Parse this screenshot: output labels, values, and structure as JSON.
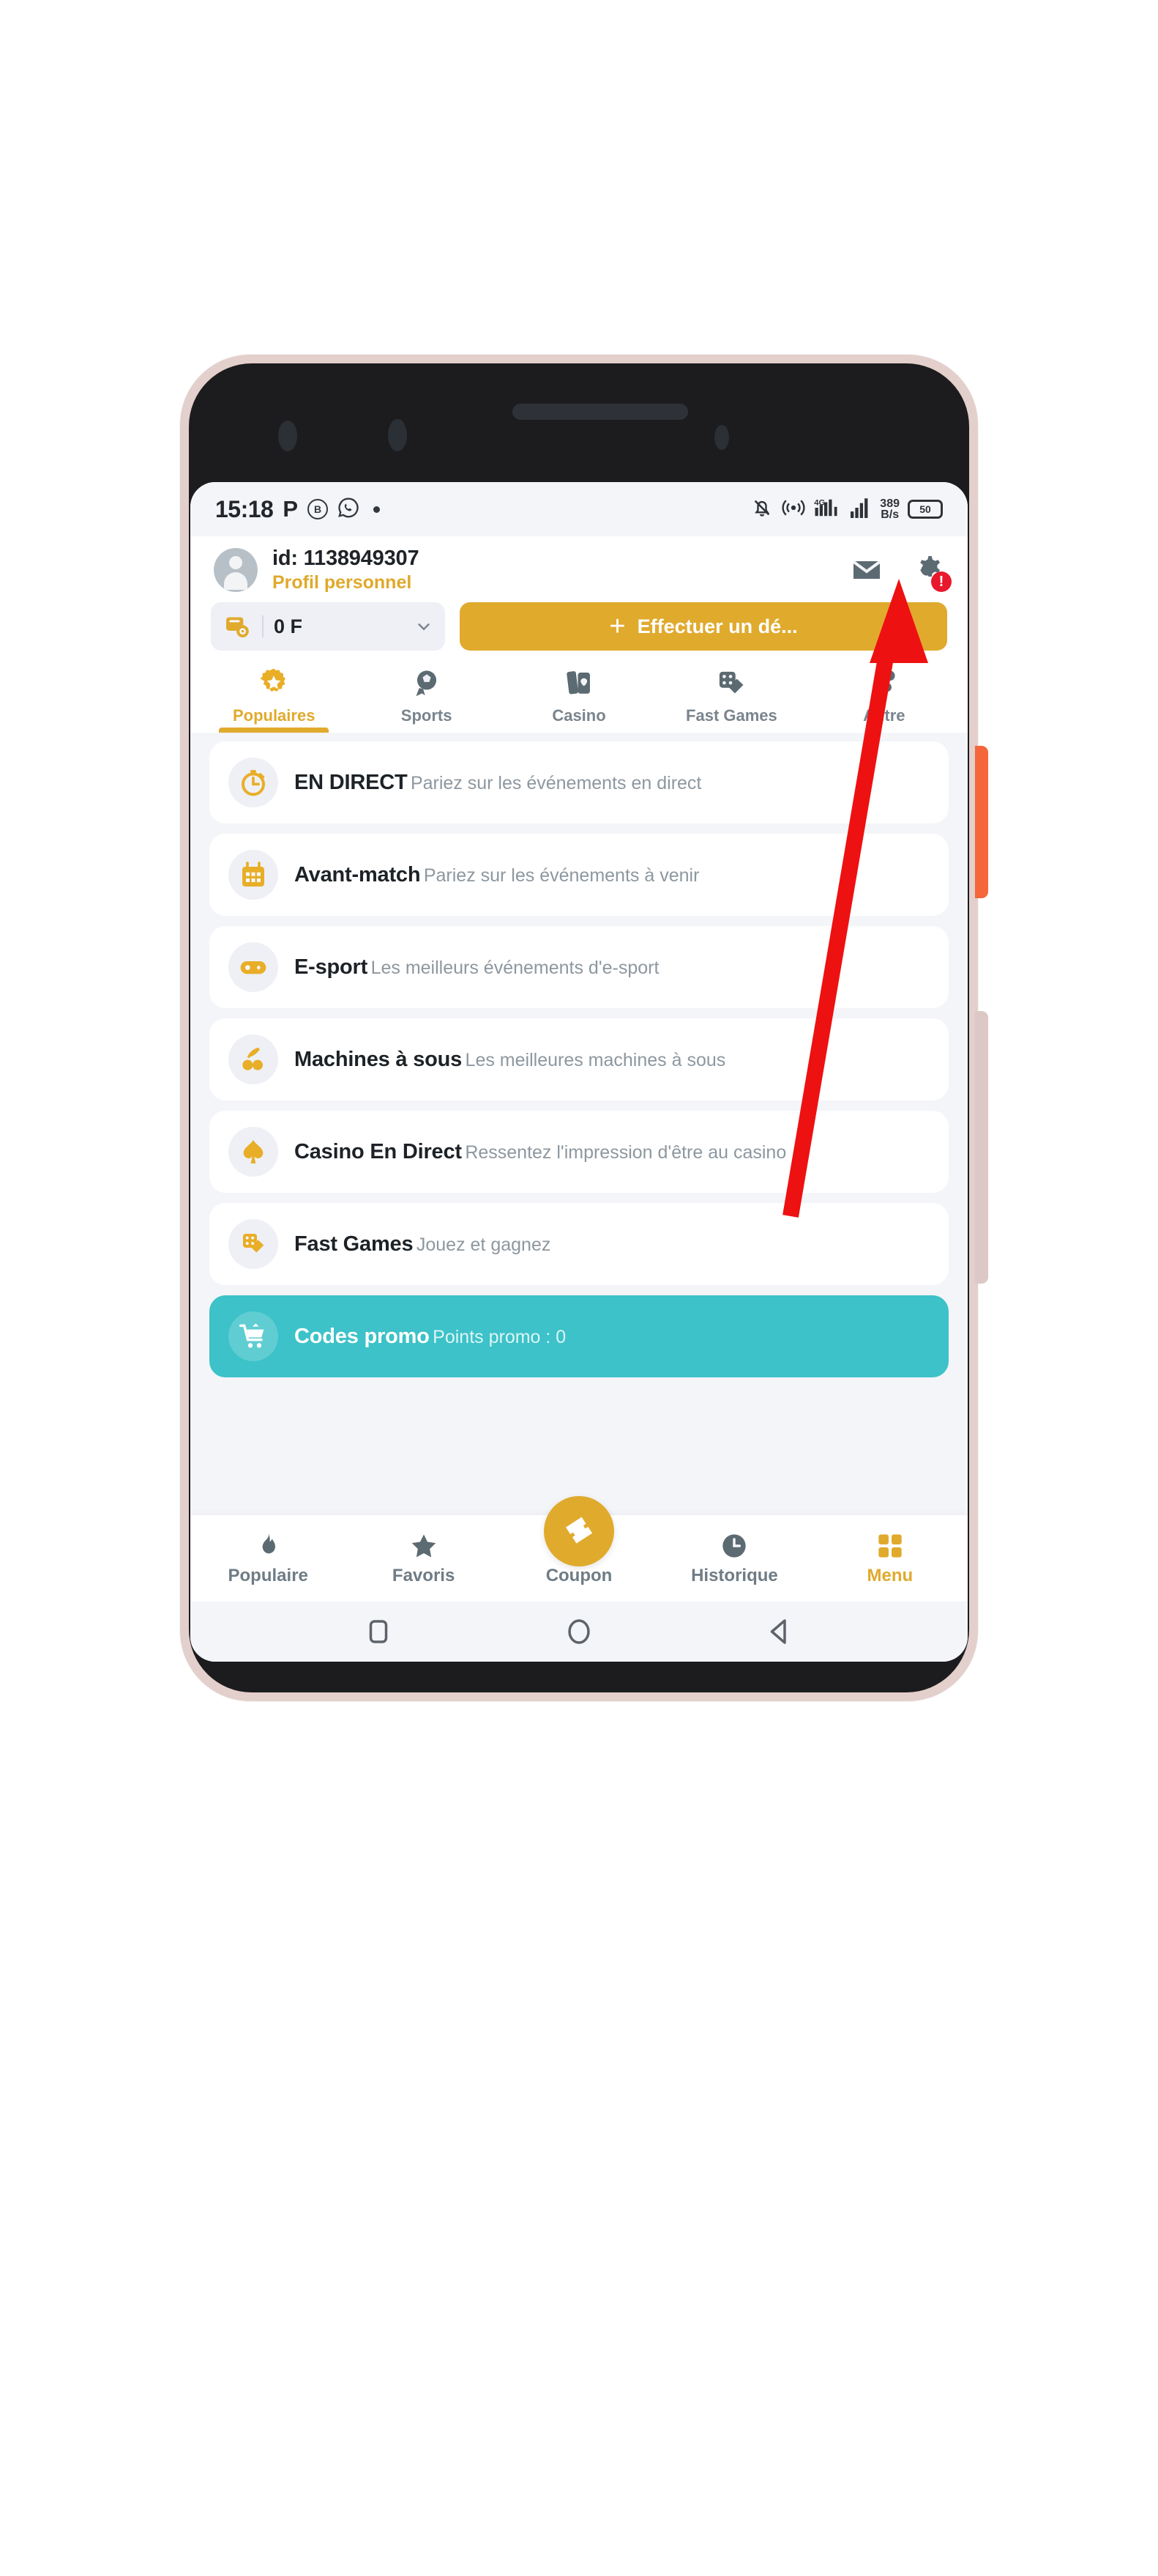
{
  "status_bar": {
    "time": "15:18",
    "p_indicator": "P",
    "badge_letter": "B",
    "whatsapp_icon": "whatsapp-icon",
    "dot_icon": "dot-indicator",
    "mute_icon": "bell-muted-icon",
    "hotspot_icon": "hotspot-icon",
    "signal_4g_label": "4G",
    "network_speed_value": "389",
    "network_speed_unit": "B/s",
    "battery_percent": "50"
  },
  "header": {
    "user_id": "id: 1138949307",
    "profile_label": "Profil personnel",
    "mail_icon": "envelope-icon",
    "settings_icon": "gear-icon",
    "settings_badge": "!"
  },
  "balance": {
    "wallet_icon": "wallet-icon",
    "amount": "0 F",
    "chevron_icon": "chevron-down-icon",
    "deposit_label": "Effectuer un dé...",
    "deposit_plus": "+"
  },
  "category_tabs": [
    {
      "label": "Populaires",
      "icon": "star-gear-icon",
      "active": true
    },
    {
      "label": "Sports",
      "icon": "football-icon",
      "active": false
    },
    {
      "label": "Casino",
      "icon": "cards-icon",
      "active": false
    },
    {
      "label": "Fast Games",
      "icon": "dice-cards-icon",
      "active": false
    },
    {
      "label": "Autre",
      "icon": "more-dots-icon",
      "active": false
    }
  ],
  "list_items": [
    {
      "title": "EN DIRECT",
      "subtitle": "Pariez sur les événements en direct",
      "icon": "stopwatch-icon",
      "highlight": false
    },
    {
      "title": "Avant-match",
      "subtitle": "Pariez sur les événements à venir",
      "icon": "calendar-icon",
      "highlight": false
    },
    {
      "title": "E-sport",
      "subtitle": "Les meilleurs événements d'e-sport",
      "icon": "gamepad-icon",
      "highlight": false
    },
    {
      "title": "Machines à sous",
      "subtitle": "Les meilleures machines à sous",
      "icon": "cherries-icon",
      "highlight": false
    },
    {
      "title": "Casino En Direct",
      "subtitle": "Ressentez l'impression d'être au casino",
      "icon": "spade-icon",
      "highlight": false
    },
    {
      "title": "Fast Games",
      "subtitle": "Jouez et gagnez",
      "icon": "dice-cards-icon",
      "highlight": false
    },
    {
      "title": "Codes promo",
      "subtitle": "Points promo : 0",
      "icon": "cart-icon",
      "highlight": true
    }
  ],
  "bottom_nav": [
    {
      "label": "Populaire",
      "icon": "flame-icon",
      "active": false
    },
    {
      "label": "Favoris",
      "icon": "star-icon",
      "active": false
    },
    {
      "label": "Coupon",
      "icon": "ticket-icon",
      "active": false
    },
    {
      "label": "Historique",
      "icon": "clock-icon",
      "active": false
    },
    {
      "label": "Menu",
      "icon": "grid-icon",
      "active": true
    }
  ],
  "android_nav": {
    "recents_icon": "square-recents-icon",
    "home_icon": "circle-home-icon",
    "back_icon": "triangle-back-icon"
  },
  "annotation": {
    "arrow_color": "#ee1111",
    "points_to": "gear-icon"
  },
  "colors": {
    "accent_gold": "#e0aa2d",
    "promo_teal": "#3cc2c8",
    "alert_red": "#e8192c",
    "screen_bg": "#f4f5f9",
    "device_frame": "#e3cfcb",
    "device_body": "#1c1c1e",
    "power_button": "#f5663a"
  }
}
